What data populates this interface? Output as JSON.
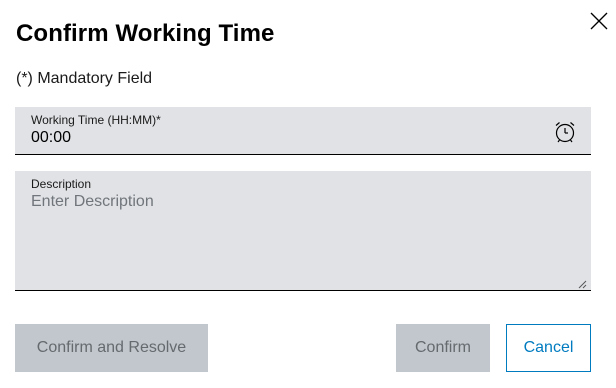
{
  "dialog": {
    "title": "Confirm Working Time",
    "mandatory_note": "(*) Mandatory Field",
    "close_icon": "close-icon"
  },
  "working_time": {
    "label": "Working Time (HH:MM)*",
    "value": "00:00",
    "icon": "alarm-clock-icon"
  },
  "description": {
    "label": "Description",
    "value": "",
    "placeholder": "Enter Description"
  },
  "buttons": {
    "confirm_and_resolve": "Confirm and Resolve",
    "confirm": "Confirm",
    "cancel": "Cancel"
  },
  "colors": {
    "field_bg": "#e0e2e5",
    "disabled_bg": "#c1c7cc",
    "disabled_text": "#656a6f",
    "accent": "#007bc0"
  }
}
